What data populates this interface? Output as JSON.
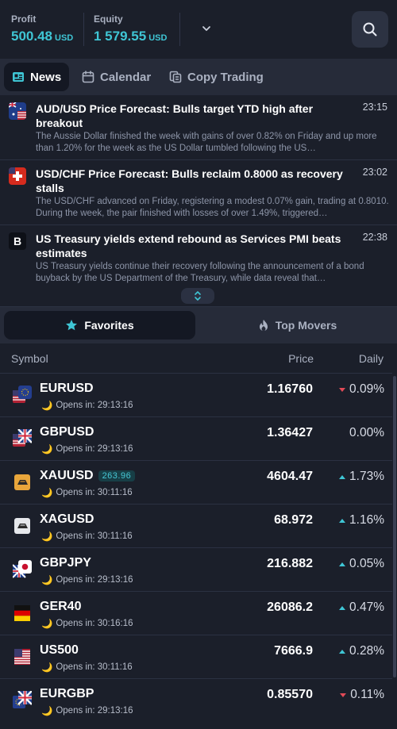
{
  "account": {
    "profit_label": "Profit",
    "profit_value": "500.48",
    "profit_currency": "USD",
    "equity_label": "Equity",
    "equity_value": "1 579.55",
    "equity_currency": "USD"
  },
  "tabs": [
    {
      "label": "News",
      "active": true
    },
    {
      "label": "Calendar",
      "active": false
    },
    {
      "label": "Copy Trading",
      "active": false
    }
  ],
  "news": [
    {
      "title": "AUD/USD Price Forecast: Bulls target YTD high after breakout",
      "time": "23:15",
      "body": "The Aussie Dollar finished the week with gains of over 0.82% on Friday and up more than 1.20% for the week as the US Dollar tumbled following the US…"
    },
    {
      "title": "USD/CHF Price Forecast: Bulls reclaim 0.8000 as recovery stalls",
      "time": "23:02",
      "body": "The USD/CHF advanced on Friday, registering a modest 0.07% gain, trading at 0.8010. During the week, the pair finished with losses of over 1.49%, triggered…"
    },
    {
      "title": "US Treasury yields extend rebound as Services PMI beats estimates",
      "time": "22:38",
      "body": "US Treasury yields continue their recovery following the announcement of a bond buyback by the US Department of the Treasury, while data reveal that…",
      "icon_letter": "B"
    }
  ],
  "segments": [
    {
      "label": "Favorites",
      "active": true
    },
    {
      "label": "Top Movers",
      "active": false
    }
  ],
  "table": {
    "col_symbol": "Symbol",
    "col_price": "Price",
    "col_daily": "Daily"
  },
  "colors": {
    "accent": "#3fc6d5",
    "negative": "#e24a57"
  },
  "instruments": [
    {
      "symbol": "EURUSD",
      "opens": "Opens in: 29:13:16",
      "price": "1.16760",
      "daily": "0.09%",
      "dir": "down",
      "flag": "eu-us"
    },
    {
      "symbol": "GBPUSD",
      "opens": "Opens in: 29:13:16",
      "price": "1.36427",
      "daily": "0.00%",
      "dir": "none",
      "flag": "gb-us"
    },
    {
      "symbol": "XAUUSD",
      "badge": "263.96",
      "opens": "Opens in: 30:11:16",
      "price": "4604.47",
      "daily": "1.73%",
      "dir": "up",
      "flag": "gold"
    },
    {
      "symbol": "XAGUSD",
      "opens": "Opens in: 30:11:16",
      "price": "68.972",
      "daily": "1.16%",
      "dir": "up",
      "flag": "silver"
    },
    {
      "symbol": "GBPJPY",
      "opens": "Opens in: 29:13:16",
      "price": "216.882",
      "daily": "0.05%",
      "dir": "up",
      "flag": "gb-jp"
    },
    {
      "symbol": "GER40",
      "opens": "Opens in: 30:16:16",
      "price": "26086.2",
      "daily": "0.47%",
      "dir": "up",
      "flag": "de"
    },
    {
      "symbol": "US500",
      "opens": "Opens in: 30:11:16",
      "price": "7666.9",
      "daily": "0.28%",
      "dir": "up",
      "flag": "us"
    },
    {
      "symbol": "EURGBP",
      "opens": "Opens in: 29:13:16",
      "price": "0.85570",
      "daily": "0.11%",
      "dir": "down",
      "flag": "eu-gb"
    }
  ]
}
